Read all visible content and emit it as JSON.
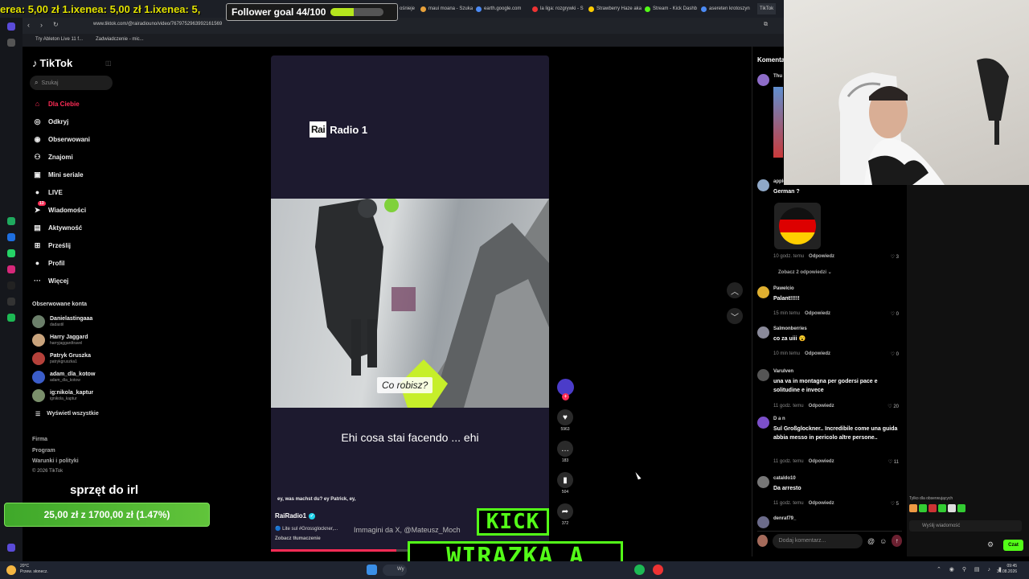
{
  "overlay": {
    "ticker": "erea: 5,00 zł  1.ixenea: 5,00 zł  1.ixenea: 5,",
    "follower_goal": {
      "label": "Follower goal 44/100",
      "current": 44,
      "target": 100
    },
    "irl_title": "sprzęt do irl",
    "donation": {
      "label": "25,00 zł z 1700,00 zł (1.47%)",
      "percent": 1.47
    },
    "kick_line1": "KICK",
    "kick_line2": "WIRAZKA_A"
  },
  "browser": {
    "url": "www.tiktok.com/@rairadiouno/video/7679752963992161569",
    "bookmarks": [
      "Try Ableton Live 11 f...",
      "Zadwiadczenie - mic..."
    ],
    "tabs": [
      "ośnieje",
      "maui moana - Szuka",
      "earth.google.com",
      "la liga: rozgrywki - S",
      "Strawberry Haze aka",
      "Stream - Kick Dashb",
      "asereten krotoszyn",
      "TikTok"
    ]
  },
  "tiktok": {
    "logo": "TikTok",
    "search_placeholder": "Szukaj",
    "nav": [
      {
        "label": "Dla Ciebie",
        "icon": "home-icon",
        "active": true
      },
      {
        "label": "Odkryj",
        "icon": "compass-icon"
      },
      {
        "label": "Obserwowani",
        "icon": "following-icon"
      },
      {
        "label": "Znajomi",
        "icon": "friends-icon"
      },
      {
        "label": "Mini seriale",
        "icon": "series-icon"
      },
      {
        "label": "LIVE",
        "icon": "live-icon"
      },
      {
        "label": "Wiadomości",
        "icon": "messages-icon",
        "badge": "13"
      },
      {
        "label": "Aktywność",
        "icon": "activity-icon"
      },
      {
        "label": "Prześlij",
        "icon": "upload-icon"
      },
      {
        "label": "Profil",
        "icon": "profile-icon"
      },
      {
        "label": "Więcej",
        "icon": "more-icon"
      }
    ],
    "followed_title": "Obserwowane konta",
    "followed": [
      {
        "name": "Danielastingaaa",
        "handle": "dadastil",
        "color": "#6b7f6a"
      },
      {
        "name": "Harry Jaggard",
        "handle": "harryjaggardtravel",
        "color": "#c9a37c"
      },
      {
        "name": "Patryk Gruszka",
        "handle": "patrykgruszka1",
        "color": "#b5413a"
      },
      {
        "name": "adam_dla_kotow",
        "handle": "adam_dla_kotow",
        "color": "#3b5dc9"
      },
      {
        "name": "ig:nikola_kaptur",
        "handle": "ignikola_kaptur",
        "color": "#7a8f6b"
      }
    ],
    "show_all": "Wyświetl wszystkie",
    "footer": [
      "Firma",
      "Program",
      "Warunki i polityki",
      "© 2026 TikTok"
    ]
  },
  "video": {
    "logo_box": "Rai",
    "logo_text": "Radio 1",
    "subtitle_pl": "Co robisz?",
    "subtitle_it": "Ehi cosa stai facendo ... ehi",
    "caption_de": "ey, was machst du? ey Patrick, ey,",
    "author": "RaiRadio1",
    "description": "🔵 Lite sul #Grossglockner,...",
    "image_credit": "Immagini da X, @Mateusz_Moch",
    "see_translation": "Zobacz tłumaczenie",
    "progress": 0.45,
    "likes": "5963",
    "comments": "183",
    "saves": "504",
    "shares": "372"
  },
  "comments": {
    "header": "Komentarze",
    "items": [
      {
        "user": "appleseed",
        "text": "German ?",
        "time": "10 godz. temu",
        "reply": "Odpowiedz",
        "likes": "3",
        "color": "#8fa8c8"
      },
      {
        "user": "Pawelcio",
        "text": "Palant!!!!!",
        "time": "15 min temu",
        "reply": "Odpowiedz",
        "likes": "0",
        "color": "#e0b030"
      },
      {
        "user": "Salmonberries",
        "text": "co za uiii 😮",
        "time": "10 min temu",
        "reply": "Odpowiedz",
        "likes": "0",
        "color": "#8a8a9a"
      },
      {
        "user": "Varulven",
        "text": "una va in montagna per godersi pace e solitudine e invece",
        "time": "11 godz. temu",
        "reply": "Odpowiedz",
        "likes": "20",
        "color": "#555"
      },
      {
        "user": "D a n",
        "text": "Sul Großglockner.. Incredibile come una guida abbia messo in pericolo altre persone..",
        "time": "11 godz. temu",
        "reply": "Odpowiedz",
        "likes": "11",
        "color": "#7b4fc9"
      },
      {
        "user": "cataldo10",
        "text": "Da arresto",
        "time": "11 godz. temu",
        "reply": "Odpowiedz",
        "likes": "5",
        "color": "#777"
      },
      {
        "user": "denraf79_",
        "text": "",
        "time": "",
        "reply": "",
        "likes": "",
        "color": "#6b6b8a"
      }
    ],
    "see_replies": "Zobacz 2 odpowiedzi ⌄",
    "input_placeholder": "Dodaj komentarz...",
    "send_icon": "arrow-up-icon"
  },
  "chat": {
    "note": "Tylko dla obserwujących",
    "input_placeholder": "Wyślij wiadomość",
    "send_label": "Czat"
  },
  "taskbar": {
    "weather_temp": "20°C",
    "weather_desc": "Przew. słonecz.",
    "time": "09:45",
    "date": "31.08.2026",
    "search_label": "Wy"
  },
  "colors": {
    "tiktok_red": "#fe2c55",
    "kick_green": "#53fc18",
    "donation_green": "#4fb530"
  }
}
